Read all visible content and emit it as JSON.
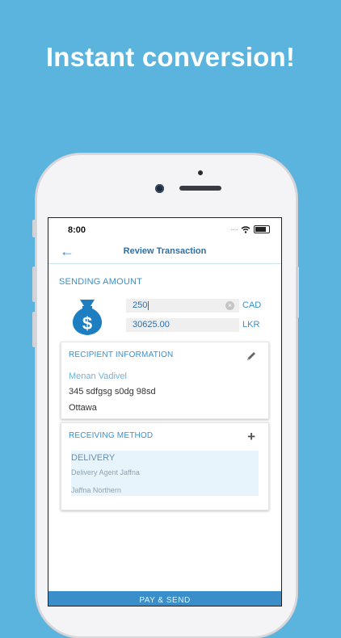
{
  "headline": "Instant conversion!",
  "status_bar": {
    "time": "8:00"
  },
  "nav": {
    "title": "Review Transaction"
  },
  "sending": {
    "label": "SENDING AMOUNT",
    "amount_value": "250",
    "amount_currency": "CAD",
    "converted_value": "30625.00",
    "converted_currency": "LKR"
  },
  "recipient": {
    "title": "RECIPIENT INFORMATION",
    "name": "Menan Vadivel",
    "address": "345 sdfgsg s0dg 98sd",
    "city": "Ottawa"
  },
  "receiving": {
    "title": "RECEIVING METHOD",
    "type": "DELIVERY",
    "agent": "Delivery Agent Jaffna",
    "region": "Jaffna Northern"
  },
  "footer": {
    "pay_label": "PAY & SEND"
  },
  "colors": {
    "background": "#5bb4de",
    "accent": "#3a8fca"
  }
}
